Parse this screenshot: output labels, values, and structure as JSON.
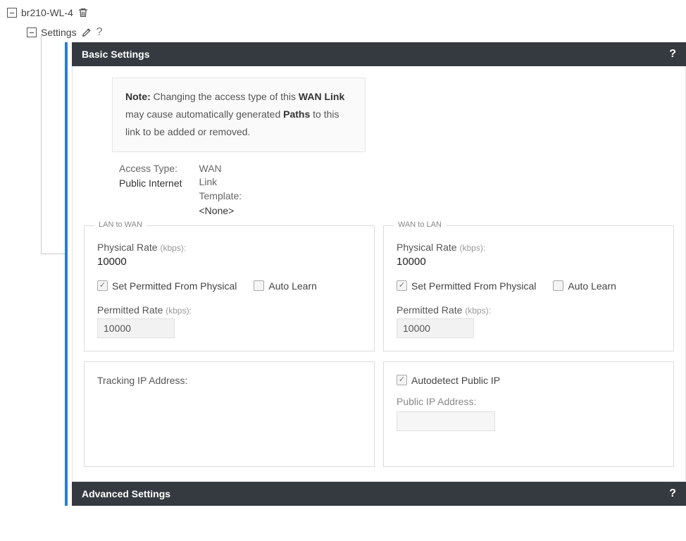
{
  "tree": {
    "root_label": "br210-WL-4",
    "settings_label": "Settings"
  },
  "sections": {
    "basic_title": "Basic Settings",
    "advanced_title": "Advanced Settings"
  },
  "note": {
    "prefix": "Note:",
    "part1": " Changing the access type of this ",
    "bold1": "WAN Link",
    "part2": " may cause automatically generated ",
    "bold2": "Paths",
    "part3": " to this link to be added or removed."
  },
  "meta": {
    "access_type_label": "Access Type:",
    "access_type_value": "Public Internet",
    "template_label": "WAN\nLink\nTemplate:",
    "template_value": "<None>"
  },
  "lan_to_wan": {
    "legend": "LAN to WAN",
    "phys_label": "Physical Rate ",
    "phys_unit": "(kbps):",
    "phys_value": "10000",
    "set_permitted_label": "Set Permitted From Physical",
    "set_permitted_checked": true,
    "auto_learn_label": "Auto Learn",
    "auto_learn_checked": false,
    "permitted_label": "Permitted Rate ",
    "permitted_unit": "(kbps):",
    "permitted_value": "10000"
  },
  "wan_to_lan": {
    "legend": "WAN to LAN",
    "phys_label": "Physical Rate ",
    "phys_unit": "(kbps):",
    "phys_value": "10000",
    "set_permitted_label": "Set Permitted From Physical",
    "set_permitted_checked": true,
    "auto_learn_label": "Auto Learn",
    "auto_learn_checked": false,
    "permitted_label": "Permitted Rate ",
    "permitted_unit": "(kbps):",
    "permitted_value": "10000"
  },
  "tracking": {
    "label": "Tracking IP Address:"
  },
  "public_ip": {
    "autodetect_label": "Autodetect Public IP",
    "autodetect_checked": true,
    "public_ip_label": "Public IP Address:",
    "public_ip_value": ""
  },
  "help_glyph": "?"
}
